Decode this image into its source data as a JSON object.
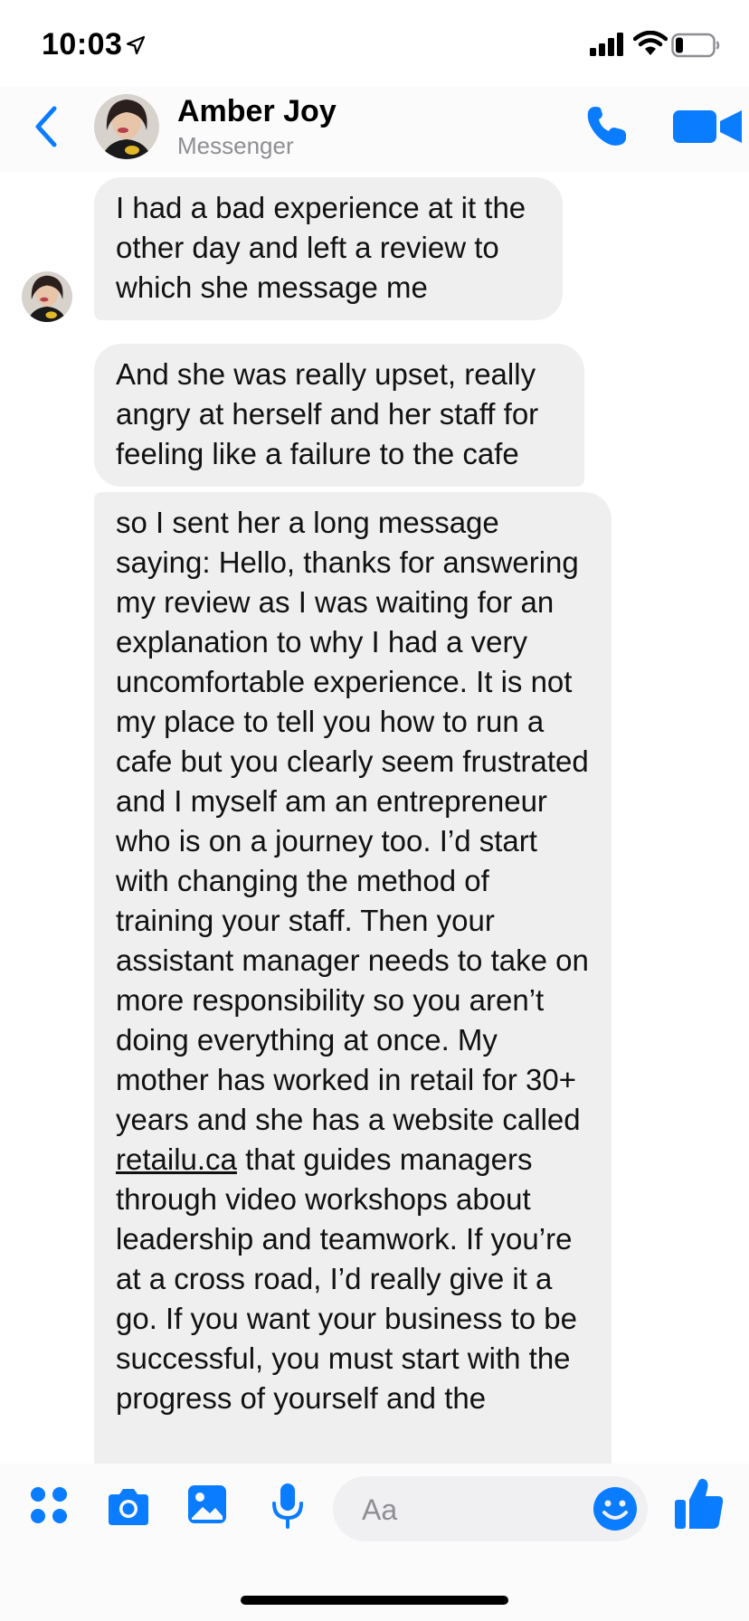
{
  "status_bar": {
    "time": "10:03",
    "icons": [
      "location-arrow-icon",
      "signal-icon",
      "wifi-icon",
      "battery-icon"
    ]
  },
  "header": {
    "contact_name": "Amber Joy",
    "subtitle": "Messenger",
    "icons": [
      "back-icon",
      "avatar",
      "call-icon",
      "video-call-icon"
    ]
  },
  "messages": [
    {
      "text": "I had a bad experience at it the other day and left a review to which she message me"
    },
    {
      "text": "And she was really upset, really angry at herself and her staff for feeling like a failure to the cafe"
    },
    {
      "text_before_link": "so I sent her a long message saying: Hello, thanks for answering my review as I was waiting for an explanation to why I had a very uncomfortable experience. It is not my place to tell you how to run a cafe but you clearly seem frustrated and I myself am an entrepreneur who is on a journey too. I’d start with changing the method of training your staff. Then your assistant manager needs to take on more responsibility so you aren’t doing everything at once. My mother has worked in retail for 30+ years and she has a website called ",
      "link": "retailu.ca",
      "text_after_link": " that guides managers through video workshops about leadership and teamwork. If you’re at a cross road, I’d really give it a go. If you want your business to be successful, you must start with the progress of yourself and the"
    }
  ],
  "composer": {
    "placeholder": "Aa",
    "icons": [
      "apps-icon",
      "camera-icon",
      "photo-icon",
      "microphone-icon",
      "emoji-icon",
      "thumbs-up-icon"
    ]
  },
  "colors": {
    "accent": "#0a7cff",
    "bubble": "#efefef",
    "subtitle": "#8e8e93"
  }
}
